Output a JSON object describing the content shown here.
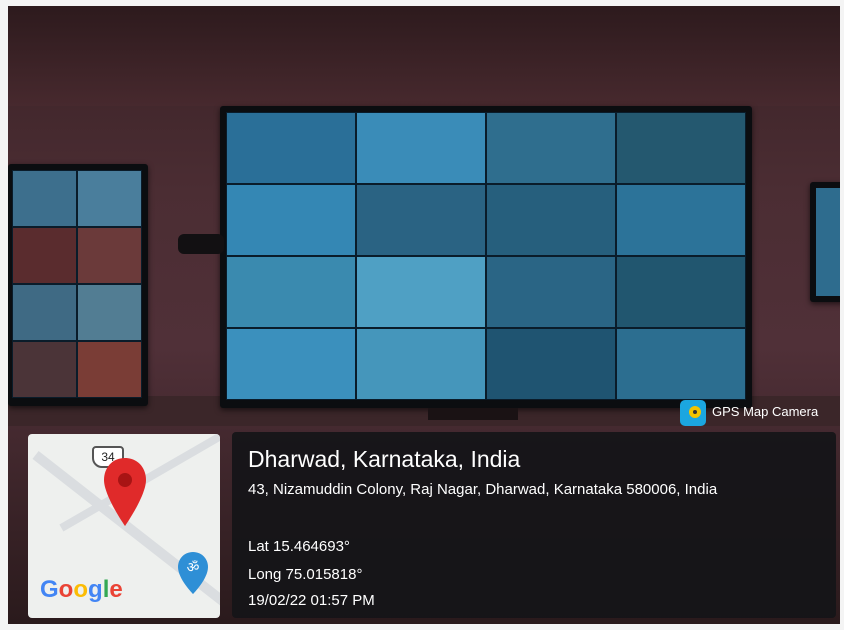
{
  "badge": {
    "label": "GPS Map Camera",
    "icon": "gps-map-camera-logo"
  },
  "location": {
    "title": "Dharwad, Karnataka, India",
    "address": "43, Nizamuddin Colony, Raj Nagar, Dharwad, Karnataka 580006, India",
    "lat": "Lat 15.464693°",
    "long": "Long 75.015818°",
    "datetime": "19/02/22 01:57 PM"
  },
  "map": {
    "route_shield": "34",
    "brand": "Google",
    "pin_icon": "map-pin-icon",
    "marker_icon": "om-marker-icon",
    "colors": {
      "pin": "#e02a2a",
      "marker": "#2e8fd6"
    }
  },
  "colors": {
    "cctv_cell": "#2b78a4",
    "info_panel": "#141418"
  }
}
